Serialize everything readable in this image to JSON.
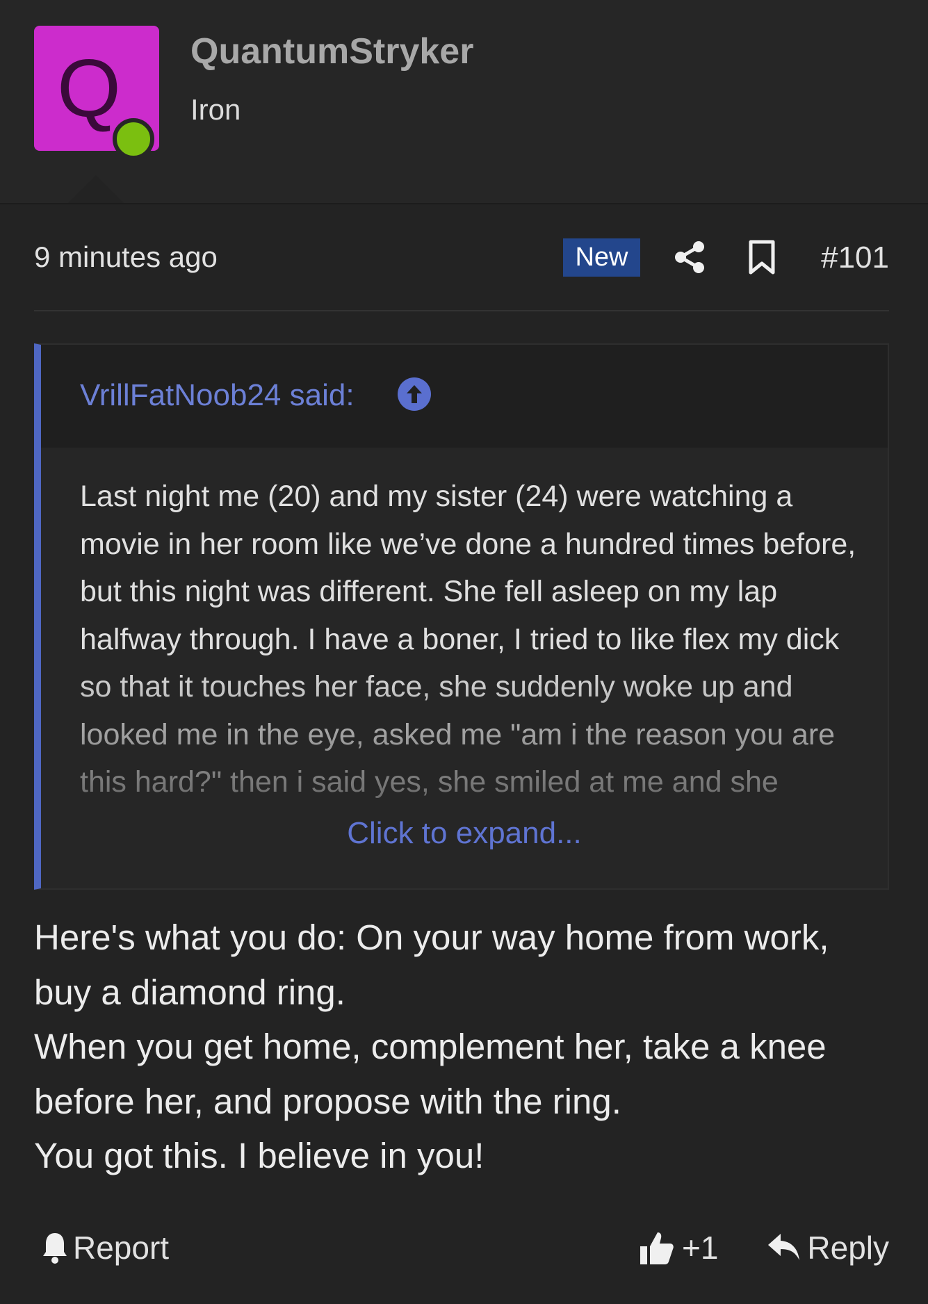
{
  "user": {
    "avatar_letter": "Q",
    "avatar_color": "#cc2ccc",
    "online_color": "#7bbf10",
    "username": "QuantumStryker",
    "title": "Iron"
  },
  "meta": {
    "timestamp": "9 minutes ago",
    "badge": "New",
    "badge_color": "#23468c",
    "share_icon": "share-icon",
    "bookmark_icon": "bookmark-icon",
    "post_number": "#101"
  },
  "quote": {
    "attribution": "VrillFatNoob24 said:",
    "accent_color": "#4f67c2",
    "up_icon": "arrow-up-circle-icon",
    "body": "Last night me (20) and my sister (24) were watching a movie in her room like we’ve done a hundred times before, but this night was different. She fell asleep on my lap halfway through. I have a boner, I tried to like flex my dick so that it touches her face, she suddenly woke up and looked me in the eye, asked me \"am i the reason you are this hard?\" then i said yes, she smiled at me and she",
    "expand_label": "Click to expand..."
  },
  "post": {
    "paragraphs": [
      "Here's what you do: On your way home from work, buy a diamond ring.",
      "When you get home, complement her, take a knee before her, and propose with the ring.",
      "You got this. I believe in you!"
    ]
  },
  "actions": {
    "report_label": "Report",
    "report_icon": "bell-icon",
    "like_label": "+1",
    "like_icon": "thumbs-up-icon",
    "reply_label": "Reply",
    "reply_icon": "reply-arrow-icon"
  }
}
